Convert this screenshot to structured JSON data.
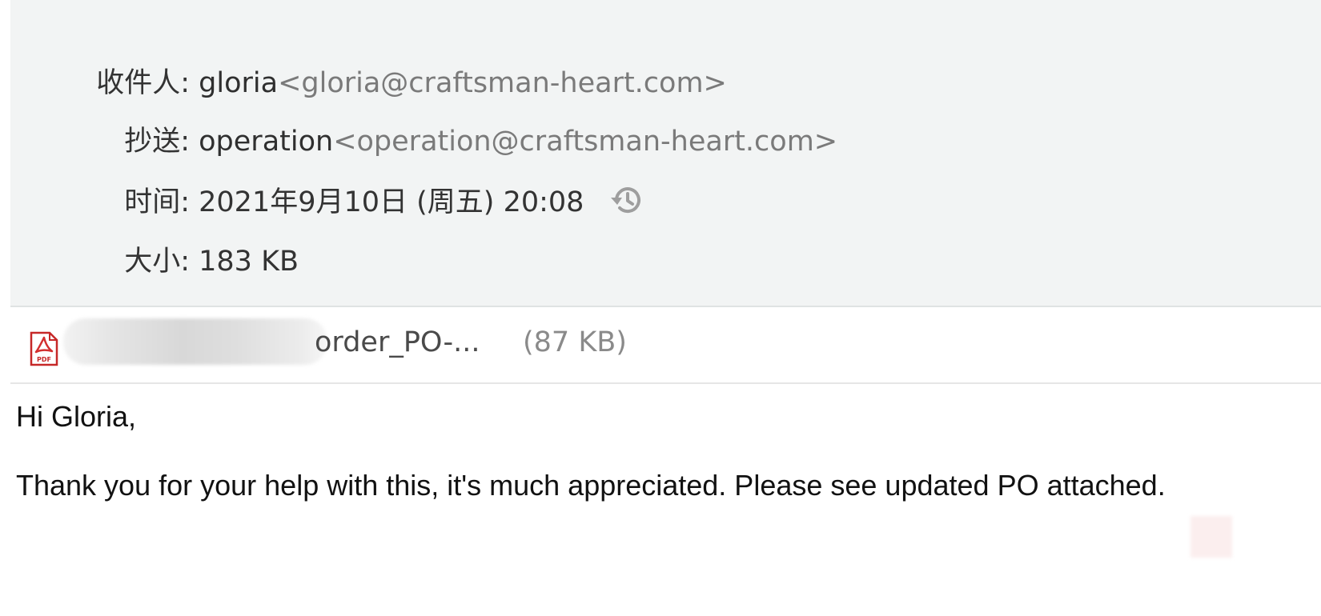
{
  "header": {
    "to": {
      "label": "收件人:",
      "name": "gloria",
      "address": "<gloria@craftsman-heart.com>"
    },
    "cc": {
      "label": "抄送:",
      "name": "operation",
      "address": "<operation@craftsman-heart.com>"
    },
    "time": {
      "label": "时间:",
      "value": "2021年9月10日 (周五) 20:08",
      "icon": "history-icon"
    },
    "size": {
      "label": "大小:",
      "value": "183 KB"
    }
  },
  "attachment": {
    "icon": "pdf-icon",
    "name_visible": "order_PO-...",
    "size": "(87 KB)"
  },
  "body": {
    "greeting": "Hi Gloria,",
    "message": "Thank you for your help with this, it's much appreciated. Please see updated PO attached."
  },
  "colors": {
    "header_bg": "#f2f4f4",
    "pdf_red": "#d32f2f",
    "address_gray": "#7a7a7a"
  }
}
